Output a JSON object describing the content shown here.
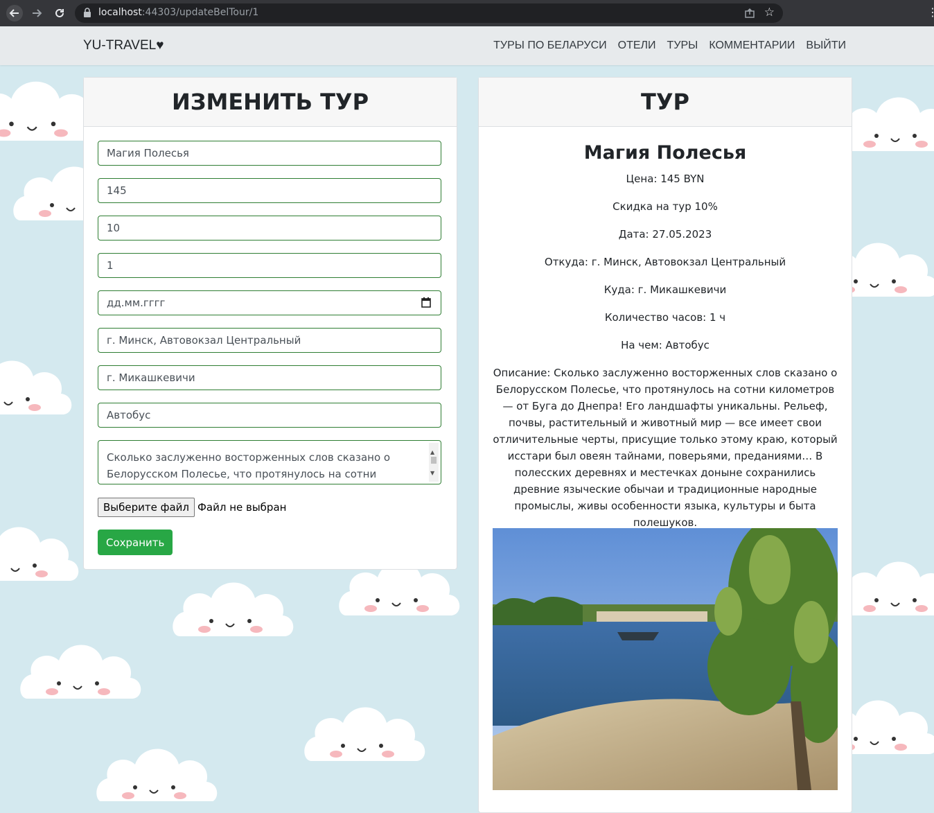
{
  "browser": {
    "url_host": "localhost",
    "url_path": ":44303/updateBelTour/1"
  },
  "navbar": {
    "brand": "YU-TRAVEL♥",
    "links": [
      "ТУРЫ ПО БЕЛАРУСИ",
      "ОТЕЛИ",
      "ТУРЫ",
      "КОММЕНТАРИИ",
      "ВЫЙТИ"
    ]
  },
  "edit_form": {
    "title": "ИЗМЕНИТЬ ТУР",
    "name": "Магия Полесья",
    "price": "145",
    "discount": "10",
    "hours": "1",
    "date_placeholder": "дд.мм.гггг",
    "from": "г. Минск, Автовокзал Центральный",
    "to": "г. Микашкевичи",
    "transport": "Автобус",
    "description": "Сколько заслуженно восторженных слов сказано о Белорусском Полесье, что протянулось на сотни километров",
    "file_button": "Выберите файл",
    "file_status": "Файл не выбран",
    "save_label": "Сохранить"
  },
  "tour_view": {
    "title": "ТУР",
    "name": "Магия Полесья",
    "price": "Цена: 145 BYN",
    "discount": "Скидка на тур 10%",
    "date": "Дата: 27.05.2023",
    "from": "Откуда: г. Минск, Автовокзал Центральный",
    "to": "Куда: г. Микашкевичи",
    "hours": "Количество часов: 1 ч",
    "transport": "На чем: Автобус",
    "description": "Описание: Сколько заслуженно восторженных слов сказано о Белорусском Полесье, что протянулось на сотни километров — от Буга до Днепра! Его ландшафты уникальны. Рельеф, почвы, расти­тельный и животный мир — все имеет свои отличительные черты, присущие только этому краю, который исстари был овеян тайна­ми, поверьями, преданиями… В полесских деревнях и местечках доныне сохранились древние языческие обычаи и традиционные народные промыслы, живы особенности языка, культуры и быта полешуков."
  },
  "colors": {
    "accent_green": "#28a745",
    "field_border": "#2e7d32",
    "page_bg": "#d4e9ef"
  }
}
